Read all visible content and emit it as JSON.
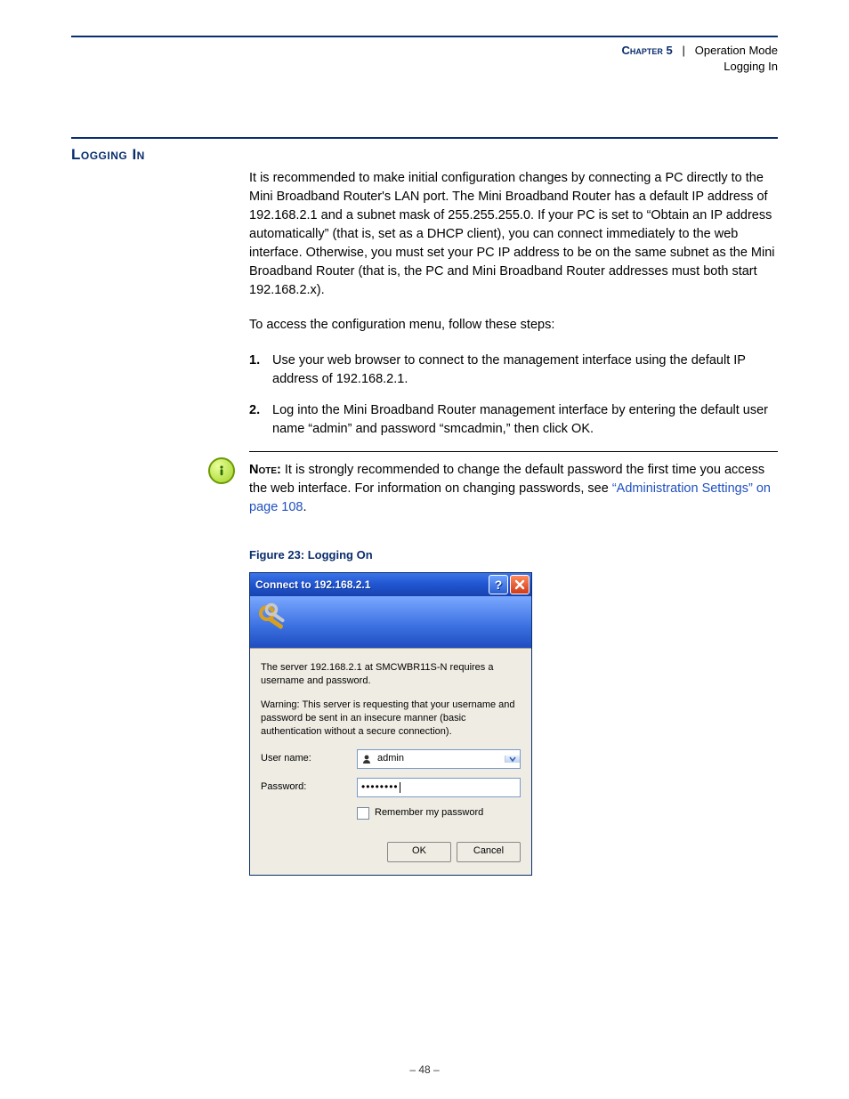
{
  "header": {
    "chapter": "Chapter 5",
    "separator": "|",
    "section": "Operation Mode",
    "subsection": "Logging In"
  },
  "section_title": "Logging In",
  "intro_para": "It is recommended to make initial configuration changes by connecting a PC directly to the Mini Broadband Router's LAN port. The Mini Broadband Router has a default IP address of 192.168.2.1 and a subnet mask of 255.255.255.0. If your PC is set to “Obtain an IP address automatically” (that is, set as a DHCP client), you can connect immediately to the web interface. Otherwise, you must set your PC IP address to be on the same subnet as the Mini Broadband Router (that is, the PC and Mini Broadband Router addresses must both start 192.168.2.x).",
  "access_line": "To access the configuration menu, follow these steps:",
  "steps": [
    "Use your web browser to connect to the management interface using the default IP address of 192.168.2.1.",
    "Log into the Mini Broadband Router management interface by entering the default user name “admin” and password “smcadmin,” then click OK."
  ],
  "note": {
    "label": "Note:",
    "text_before_link": " It is strongly recommended to change the default password the first time you access the web interface. For information on changing passwords, see ",
    "link": "“Administration Settings” on page 108",
    "text_after_link": "."
  },
  "figure_caption": "Figure 23:  Logging On",
  "dialog": {
    "title": "Connect to 192.168.2.1",
    "server_line": "The server 192.168.2.1 at SMCWBR11S-N requires a username and password.",
    "warning_line": "Warning: This server is requesting that your username and password be sent in an insecure manner (basic authentication without a secure connection).",
    "username_label": "User name:",
    "username_value": "admin",
    "password_label": "Password:",
    "password_mask": "••••••••",
    "remember_label": "Remember my password",
    "ok_label": "OK",
    "cancel_label": "Cancel"
  },
  "footer": "–  48  –"
}
